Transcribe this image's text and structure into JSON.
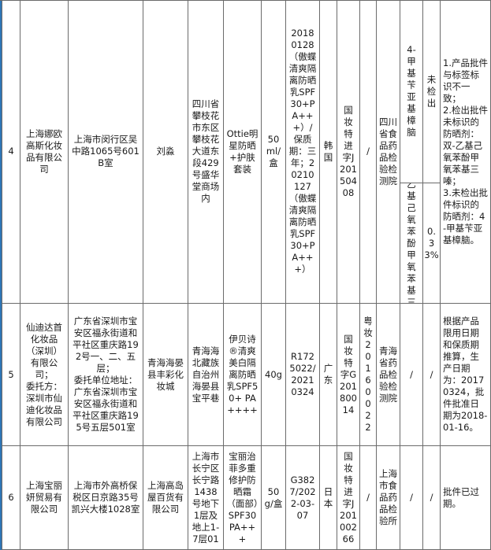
{
  "rows": [
    {
      "no": "4",
      "company": "上海娜欧高斯化妆品有限公司",
      "company_address": "上海市闵行区吴中路1065号601B室",
      "contact": "刘淼",
      "producer_address": "四川省攀枝花市东区攀枝花大道东段429号盛华堂商场内",
      "product": "Ottie明星防晒+护肤套装",
      "spec": "50ml/盒",
      "batch": "20180128（傲蝶清爽隔离防晒乳SPF30+PA+++）/保质期：三年；20210127（傲蝶清爽隔离防晒乳SPF30+PA+++）",
      "origin": "韩国",
      "license": "国妆特进字J20150408",
      "permit": "/",
      "inspector": "四川省食品药品检验检测院",
      "items": [
        "4-甲基苄亚基樟脑",
        "双-乙基己氧苯酚甲氧苯基三嗪"
      ],
      "results": [
        "未检出",
        "0.33%"
      ],
      "remark": "1.产品批件与标签标识不一致；\n2.检出批件未标识的防晒剂：双-乙基己氧苯酚甲氧苯基三嗪；\n3.未检出批件标识的防晒剂：4-甲基苄亚基樟脑。"
    },
    {
      "no": "5",
      "company": "仙迪达首化妆品（深圳）有限公司；\n委托方：深圳市仙迪化妆品有限公司",
      "company_address": "广东省深圳市宝安区福永街道和平社区重庆路192号一、二、五层；\n委托单位地址：广东省深圳市宝安区福永街道和平社区重庆路195号五层501室",
      "contact": "青海海晏县丰彩化妆城",
      "producer_address": "青海海北藏族自治州海晏县宝平巷",
      "product": "伊贝诗®清爽美白隔离防晒乳SPF50+ PA++++",
      "spec": "40g",
      "batch": "R1725022/20210324",
      "origin": "广东",
      "license": "国妆特字G20180014",
      "permit": "粤妆20160022",
      "inspector": "青海省药品检验检测院",
      "item": "/",
      "result": "/",
      "remark": "根据产品限用日期和保质期推算，生产日期为：20170324，批件批准日期为2018-01-16。"
    },
    {
      "no": "6",
      "company": "上海宝丽妍贸易有限公司",
      "company_address": "上海市外高桥保税区日京路35号凯兴大楼1028室",
      "contact": "上海高岛屋百货有限公司",
      "producer_address": "上海市长宁区长宁路1438号地下1层及地上1-7层01",
      "product": "宝丽治菲多重修护防晒霜（面部）SPF30 PA+++",
      "spec": "50g/盒",
      "batch": "G3827/2022-03-07",
      "origin": "日本",
      "license": "国妆特进字J20100266",
      "permit": "/",
      "inspector": "上海市食品药品检验所",
      "item": "/",
      "result": "/",
      "remark": "批件已过期。"
    }
  ]
}
